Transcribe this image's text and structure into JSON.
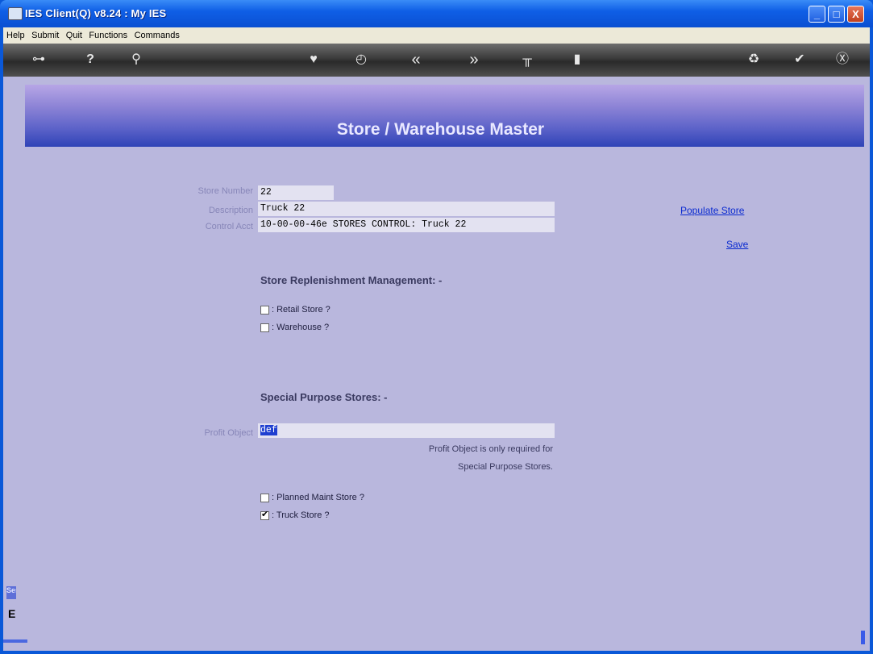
{
  "window": {
    "title": "IES Client(Q) v8.24 : My IES"
  },
  "window_controls": {
    "minimize": "_",
    "maximize": "□",
    "close": "X"
  },
  "menu": [
    "Help",
    "Submit",
    "Quit",
    "Functions",
    "Commands"
  ],
  "toolbar": {
    "icons": [
      "key-icon",
      "help-icon",
      "search-icon",
      "heart-icon",
      "clock-icon",
      "back-icon",
      "forward-icon",
      "hierarchy-icon",
      "layout-icon",
      "recycle-icon",
      "check-icon",
      "close-icon"
    ],
    "glyphs": {
      "key": "⊶",
      "help": "?",
      "search": "⚲",
      "heart": "♥",
      "clock": "◴",
      "back": "«",
      "forward": "»",
      "hierarchy": "╥",
      "layout": "▮",
      "recycle": "♻",
      "check": "✔",
      "close": "Ⓧ"
    }
  },
  "page": {
    "heading": "Store / Warehouse Master"
  },
  "form": {
    "store_number": {
      "label": "Store Number",
      "value": "22"
    },
    "description": {
      "label": "Description",
      "value": "Truck 22"
    },
    "control_acct": {
      "label": "Control Acct",
      "value": "10-00-00-46e STORES CONTROL: Truck 22"
    }
  },
  "links": {
    "populate_store": "Populate Store",
    "save": "Save"
  },
  "replenishment": {
    "heading": "Store Replenishment Management: -",
    "retail_store": {
      "label": ": Retail Store ?",
      "checked": false
    },
    "warehouse": {
      "label": ": Warehouse ?",
      "checked": false
    }
  },
  "special": {
    "heading": "Special Purpose Stores: -",
    "profit_object": {
      "label": "Profit Object",
      "value": "def"
    },
    "note_line1": "Profit Object is only required for",
    "note_line2": "Special Purpose Stores.",
    "planned_maint": {
      "label": ": Planned Maint Store ?",
      "checked": false
    },
    "truck_store": {
      "label": ": Truck Store ?",
      "checked": true
    }
  },
  "side": {
    "ses": "Ses",
    "glyph": "E"
  },
  "colors": {
    "banner_top": "#b7a6e6",
    "banner_bottom": "#2f43b7",
    "content_bg": "#b9b7dd",
    "link": "#0a2ad0"
  }
}
